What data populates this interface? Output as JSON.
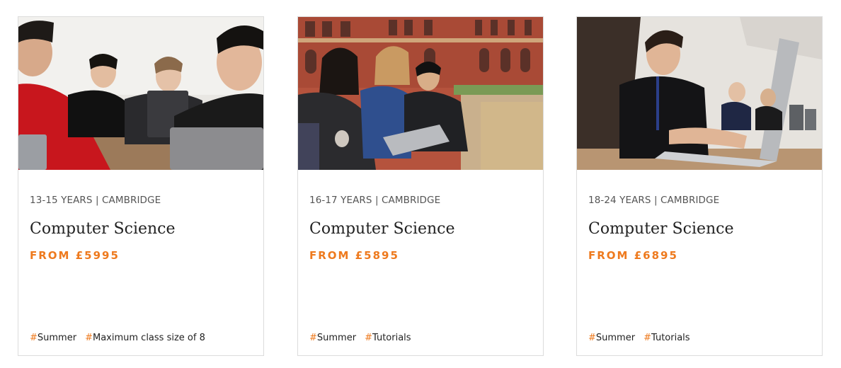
{
  "cards": [
    {
      "meta": "13-15 YEARS | CAMBRIDGE",
      "title": "Computer Science",
      "price": "FROM £5995",
      "image_alt": "Teenage students working on laptops in a classroom",
      "tags": [
        {
          "hash": "#",
          "label": "Summer"
        },
        {
          "hash": "#",
          "label": "Maximum class size of 8"
        }
      ]
    },
    {
      "meta": "16-17 YEARS | CAMBRIDGE",
      "title": "Computer Science",
      "price": "FROM £5895",
      "image_alt": "Students sitting outdoors in a courtyard looking at a laptop",
      "tags": [
        {
          "hash": "#",
          "label": "Summer"
        },
        {
          "hash": "#",
          "label": "Tutorials"
        }
      ]
    },
    {
      "meta": "18-24 YEARS | CAMBRIDGE",
      "title": "Computer Science",
      "price": "FROM £6895",
      "image_alt": "Student typing on a laptop in a computer lab",
      "tags": [
        {
          "hash": "#",
          "label": "Summer"
        },
        {
          "hash": "#",
          "label": "Tutorials"
        }
      ]
    }
  ],
  "colors": {
    "accent": "#ee7a1e",
    "meta_text": "#555555",
    "border": "#dcdcdc"
  }
}
